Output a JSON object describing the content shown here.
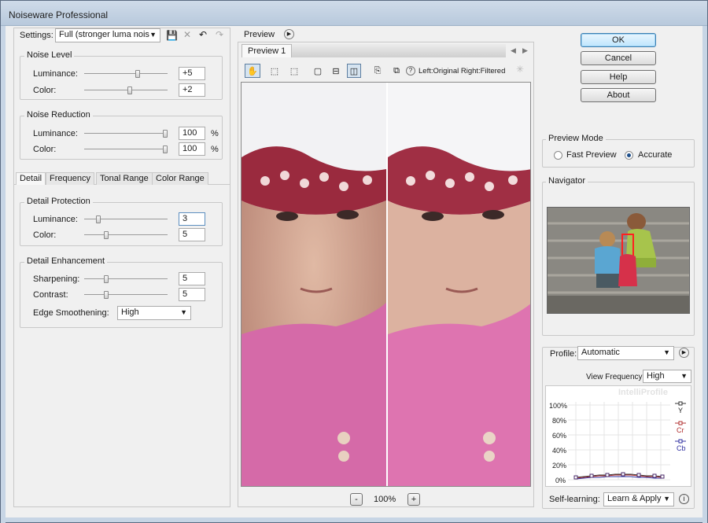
{
  "window": {
    "title": "Noiseware Professional"
  },
  "settings": {
    "label": "Settings:",
    "preset": "Full (stronger luma nois"
  },
  "noise_level": {
    "title": "Noise Level",
    "luminance_label": "Luminance:",
    "luminance_value": "+5",
    "luminance_position": 0.65,
    "color_label": "Color:",
    "color_value": "+2",
    "color_position": 0.55
  },
  "noise_reduction": {
    "title": "Noise Reduction",
    "luminance_label": "Luminance:",
    "luminance_value": "100",
    "luminance_unit": "%",
    "luminance_position": 1.0,
    "color_label": "Color:",
    "color_value": "100",
    "color_unit": "%",
    "color_position": 1.0
  },
  "tabs": [
    "Detail",
    "Frequency",
    "Tonal Range",
    "Color Range"
  ],
  "detail_protection": {
    "title": "Detail Protection",
    "luminance_label": "Luminance:",
    "luminance_value": "3",
    "luminance_position": 0.15,
    "color_label": "Color:",
    "color_value": "5",
    "color_position": 0.25
  },
  "detail_enhancement": {
    "title": "Detail Enhancement",
    "sharpening_label": "Sharpening:",
    "sharpening_value": "5",
    "sharpening_position": 0.25,
    "contrast_label": "Contrast:",
    "contrast_value": "5",
    "contrast_position": 0.25,
    "edge_label": "Edge Smoothening:",
    "edge_value": "High"
  },
  "preview": {
    "label": "Preview",
    "tab": "Preview 1",
    "compare_label": "Left:Original Right:Filtered",
    "zoom": "100%",
    "zoom_out": "-",
    "zoom_in": "+",
    "help": "?"
  },
  "buttons": {
    "ok": "OK",
    "cancel": "Cancel",
    "help": "Help",
    "about": "About"
  },
  "preview_mode": {
    "title": "Preview Mode",
    "fast": "Fast Preview",
    "accurate": "Accurate",
    "selected": "accurate"
  },
  "navigator": {
    "title": "Navigator"
  },
  "profile": {
    "label": "Profile:",
    "value": "Automatic",
    "view_frequency_label": "View Frequency:",
    "view_frequency_value": "High",
    "brand": "IntelliProfile",
    "y_ticks": [
      "100%",
      "80%",
      "60%",
      "40%",
      "20%",
      "0%"
    ],
    "legend": [
      "Y",
      "Cr",
      "Cb"
    ],
    "self_learning_label": "Self-learning:",
    "self_learning_value": "Learn & Apply"
  },
  "colors": {
    "accent": "#3c7fb1",
    "y_series": "#333333",
    "cr_series": "#b03030",
    "cb_series": "#3030a0"
  }
}
